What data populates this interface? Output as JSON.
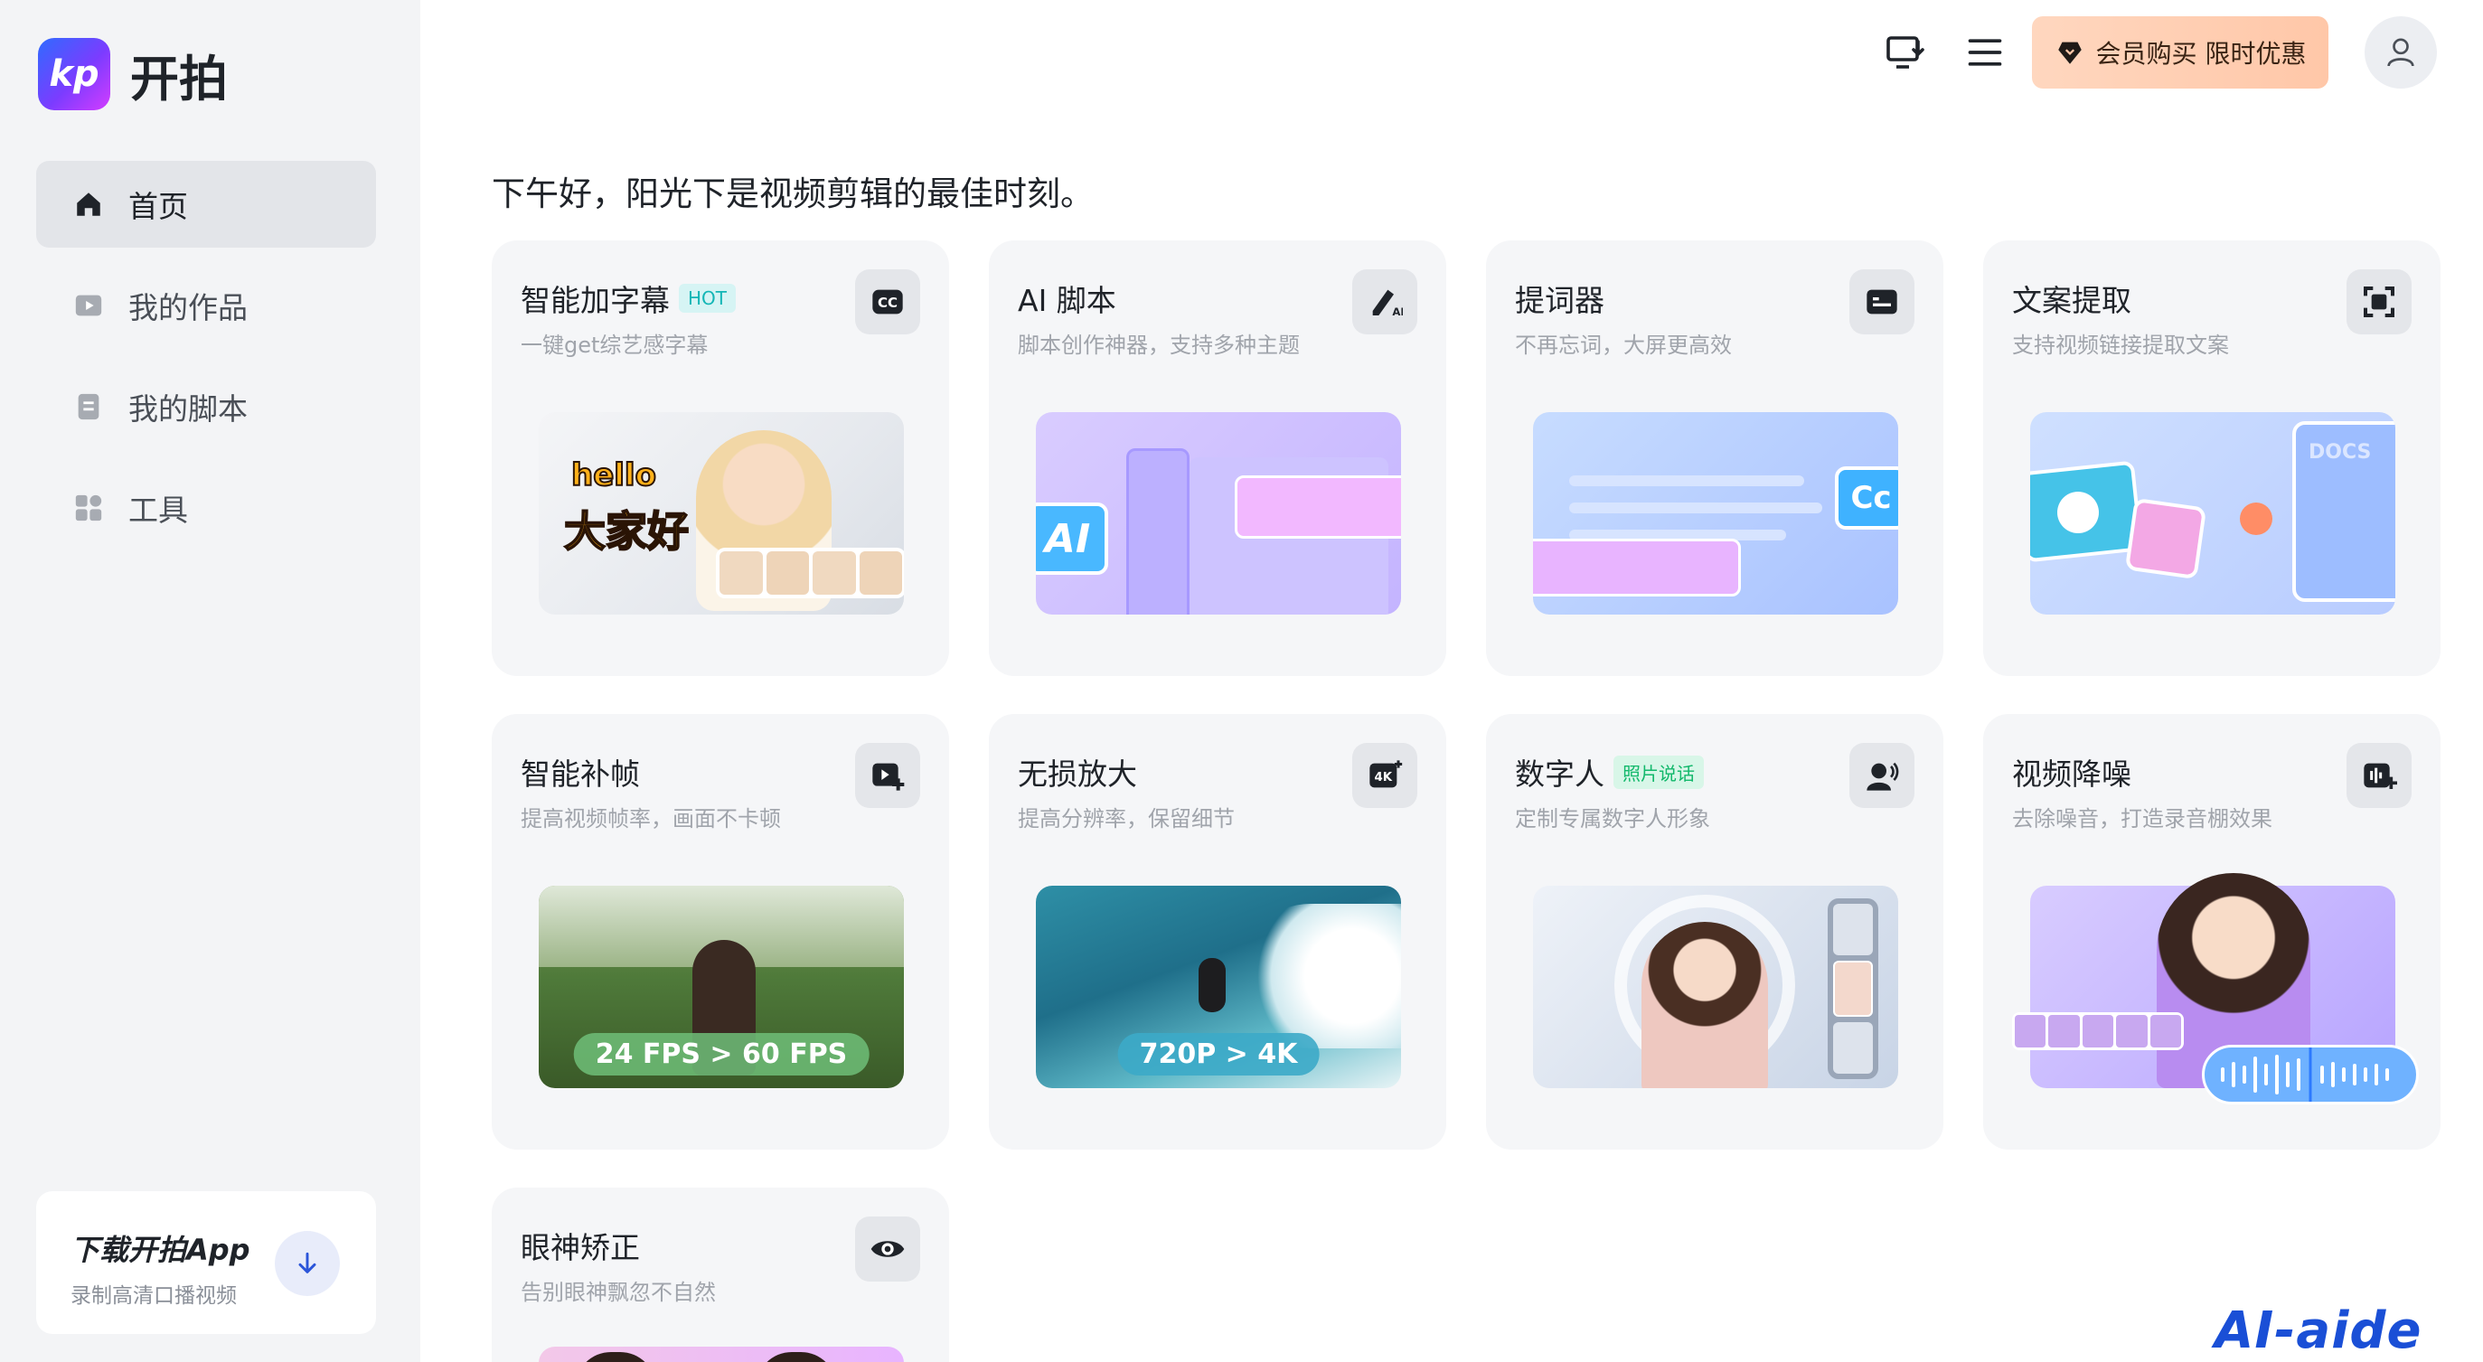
{
  "app": {
    "name": "开拍",
    "logo_glyph": "kp"
  },
  "sidebar": {
    "items": [
      {
        "label": "首页",
        "icon": "home-icon",
        "active": true
      },
      {
        "label": "我的作品",
        "icon": "play-icon",
        "active": false
      },
      {
        "label": "我的脚本",
        "icon": "document-icon",
        "active": false
      },
      {
        "label": "工具",
        "icon": "grid-icon",
        "active": false
      }
    ],
    "download": {
      "title": "下载开拍App",
      "subtitle": "录制高清口播视频"
    }
  },
  "header": {
    "vip_label": "会员购买 限时优惠"
  },
  "greeting": "下午好，阳光下是视频剪辑的最佳时刻。",
  "tools": [
    {
      "title": "智能加字幕",
      "badge": "HOT",
      "subtitle": "一键get综艺感字幕",
      "icon": "cc-icon",
      "thumb_text_1": "hello",
      "thumb_text_2": "大家好"
    },
    {
      "title": "AI 脚本",
      "badge": "",
      "subtitle": "脚本创作神器，支持多种主题",
      "icon": "ai-write-icon",
      "thumb_text_1": "AI"
    },
    {
      "title": "提词器",
      "badge": "",
      "subtitle": "不再忘词，大屏更高效",
      "icon": "teleprompter-icon",
      "thumb_text_1": "Cc"
    },
    {
      "title": "文案提取",
      "badge": "",
      "subtitle": "支持视频链接提取文案",
      "icon": "scan-icon",
      "thumb_text_1": "DOCS"
    },
    {
      "title": "智能补帧",
      "badge": "",
      "subtitle": "提高视频帧率，画面不卡顿",
      "icon": "video-plus-icon",
      "thumb_text_1": "24 FPS > 60 FPS"
    },
    {
      "title": "无损放大",
      "badge": "",
      "subtitle": "提高分辨率，保留细节",
      "icon": "4k-icon",
      "thumb_text_1": "720P > 4K"
    },
    {
      "title": "数字人",
      "badge": "照片说话",
      "subtitle": "定制专属数字人形象",
      "icon": "avatar-speak-icon"
    },
    {
      "title": "视频降噪",
      "badge": "",
      "subtitle": "去除噪音，打造录音棚效果",
      "icon": "denoise-icon"
    },
    {
      "title": "眼神矫正",
      "badge": "",
      "subtitle": "告别眼神飘忽不自然",
      "icon": "eye-icon"
    }
  ],
  "watermark": "AI-aide"
}
